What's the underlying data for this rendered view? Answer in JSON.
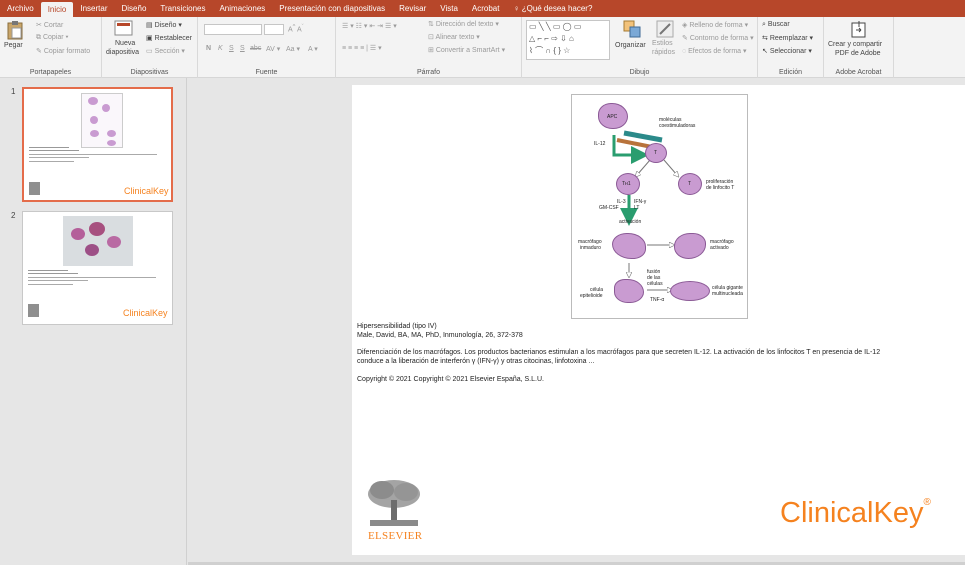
{
  "tabs": [
    "Archivo",
    "Inicio",
    "Insertar",
    "Diseño",
    "Transiciones",
    "Animaciones",
    "Presentación con diapositivas",
    "Revisar",
    "Vista",
    "Acrobat"
  ],
  "tell_me": "¿Qué desea hacer?",
  "ribbon": {
    "clipboard": {
      "paste": "Pegar",
      "cut": "Cortar",
      "copy": "Copiar",
      "format_painter": "Copiar formato",
      "label": "Portapapeles"
    },
    "slides": {
      "new_slide_1": "Nueva",
      "new_slide_2": "diapositiva",
      "layout": "Diseño",
      "reset": "Restablecer",
      "section": "Sección",
      "label": "Diapositivas"
    },
    "font": {
      "bold": "N",
      "italic": "K",
      "underline": "S",
      "strike": "S",
      "abc": "abc",
      "spacing": "AV",
      "case": "Aa",
      "label": "Fuente"
    },
    "paragraph": {
      "text_direction": "Dirección del texto",
      "align_text": "Alinear texto",
      "smartart": "Convertir a SmartArt",
      "label": "Párrafo"
    },
    "drawing": {
      "arrange": "Organizar",
      "quick_styles_1": "Estilos",
      "quick_styles_2": "rápidos",
      "fill": "Relleno de forma",
      "outline": "Contorno de forma",
      "effects": "Efectos de forma",
      "label": "Dibujo"
    },
    "editing": {
      "find": "Buscar",
      "replace": "Reemplazar",
      "select": "Seleccionar",
      "label": "Edición"
    },
    "acrobat": {
      "create_1": "Crear y compartir",
      "create_2": "PDF de Adobe",
      "label": "Adobe Acrobat"
    }
  },
  "thumbnails": [
    {
      "number": "1",
      "brand": "ClinicalKey"
    },
    {
      "number": "2",
      "brand": "ClinicalKey"
    }
  ],
  "slide": {
    "figure_labels": {
      "apc": "APC",
      "costim_1": "moléculas",
      "costim_2": "coestimuladoras",
      "il12": "IL-12",
      "t": "T",
      "th1": "Tн1",
      "t2": "T",
      "prolif_1": "proliferación",
      "prolif_2": "de linfocito T",
      "il3": "IL-3",
      "ifn": "IFN-γ",
      "gmcsf": "GM-CSF",
      "lt": "LT",
      "activation": "activación",
      "immature_1": "macrófago",
      "immature_2": "inmaduro",
      "activated_1": "macrófago",
      "activated_2": "activado",
      "fusion_1": "fusión",
      "fusion_2": "de las",
      "fusion_3": "células",
      "epithelioid_1": "célula",
      "epithelioid_2": "epitelioide",
      "giant_1": "célula gigante",
      "giant_2": "multinucleada",
      "tnf": "TNF-α"
    },
    "title": "Hipersensibilidad (tipo IV)",
    "citation": "Male, David, BA, MA, PhD, Inmunología, 26, 372-378",
    "description_1": "Diferenciación de los macrófagos. Los productos bacterianos estimulan a los macrófagos para que secreten IL-12. La activación de los linfocitos T en presencia de IL-12",
    "description_2": "conduce a la liberación de interferón γ (IFN-γ) y otras citocinas, linfotoxina ...",
    "copyright": "Copyright © 2021   Copyright © 2021 Elsevier España, S.L.U.",
    "publisher": "ELSEVIER",
    "brand": "ClinicalKey",
    "brand_mark": "®"
  },
  "colors": {
    "accent": "#b7472a",
    "brand_orange": "#f5821f",
    "cell": "#c99bd1",
    "arrow_green": "#2a9d6f"
  }
}
